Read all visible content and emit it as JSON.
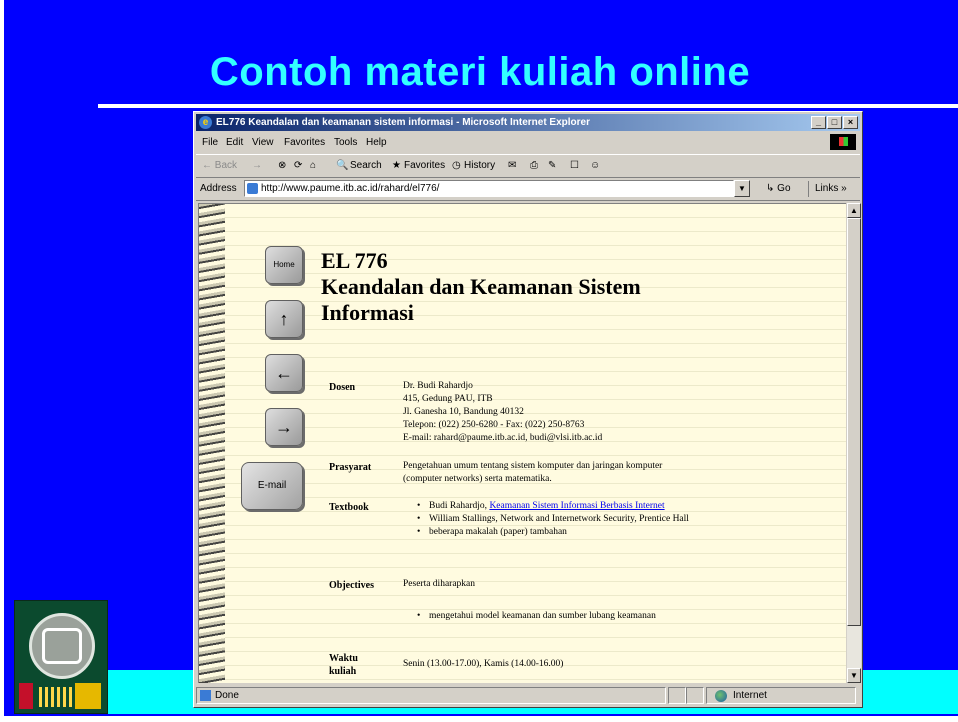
{
  "slide": {
    "title": "Contoh materi kuliah online"
  },
  "browser": {
    "window_title": "EL776 Keandalan dan keamanan sistem informasi - Microsoft Internet Explorer",
    "controls": {
      "minimize": "_",
      "maximize": "□",
      "close": "×"
    },
    "menu": [
      "File",
      "Edit",
      "View",
      "Favorites",
      "Tools",
      "Help"
    ],
    "toolbar": {
      "back": "← Back",
      "forward": "→",
      "stop": "⊗",
      "refresh": "⟳",
      "home": "⌂",
      "search": "Search",
      "favorites": "Favorites",
      "history": "History",
      "mail": "✉",
      "print": "⎙",
      "edit": "✎",
      "discuss": "☐",
      "messenger": "☺"
    },
    "address": {
      "label": "Address",
      "url": "http://www.paume.itb.ac.id/rahard/el776/",
      "go_label": "Go",
      "links_label": "Links »"
    },
    "status": {
      "text": "Done",
      "zone": "Internet"
    }
  },
  "page": {
    "nav": {
      "home": "Home",
      "up": "↑",
      "back": "←",
      "forward": "→",
      "email": "E-mail"
    },
    "course_code": "EL 776",
    "course_title_line1": "Keandalan dan Keamanan Sistem",
    "course_title_line2": "Informasi",
    "dosen": {
      "label": "Dosen",
      "lines": [
        "Dr. Budi Rahardjo",
        "415, Gedung PAU, ITB",
        "Jl. Ganesha 10, Bandung 40132",
        "Telepon: (022) 250-6280 - Fax: (022) 250-8763",
        "E-mail: rahard@paume.itb.ac.id, budi@vlsi.itb.ac.id"
      ]
    },
    "prasyarat": {
      "label": "Prasyarat",
      "lines": [
        "Pengetahuan umum tentang sistem komputer dan jaringan komputer",
        "(computer networks) serta matematika."
      ]
    },
    "textbook": {
      "label": "Textbook",
      "item1_author": "Budi Rahardjo, ",
      "item1_link": "Keamanan Sistem Informasi Berbasis Internet",
      "item2": "William Stallings, Network and Internetwork Security, Prentice Hall",
      "item3": "beberapa makalah (paper) tambahan"
    },
    "objectives": {
      "label": "Objectives",
      "intro": "Peserta diharapkan",
      "item1": "mengetahui model keamanan dan sumber lubang keamanan"
    },
    "waktu": {
      "label_line1": "Waktu",
      "label_line2": "kuliah",
      "text": "Senin (13.00-17.00), Kamis (14.00-16.00)"
    }
  }
}
